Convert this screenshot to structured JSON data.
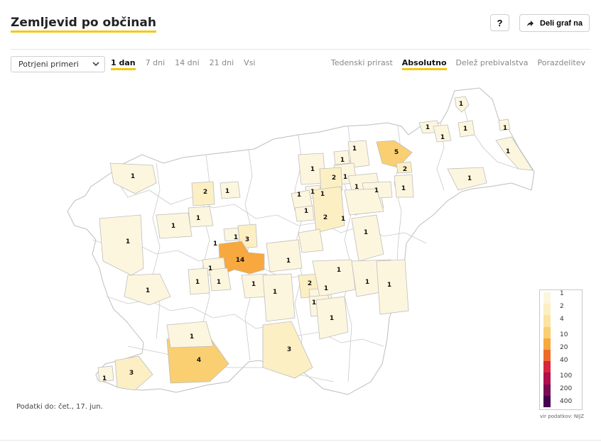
{
  "title": "Zemljevid po občinah",
  "help_label": "?",
  "share_label": "Deli graf na",
  "select": {
    "value": "Potrjeni primeri"
  },
  "ranges": [
    "1 dan",
    "7 dni",
    "14 dni",
    "21 dni",
    "Vsi"
  ],
  "ranges_active": 0,
  "modes": [
    "Tedenski prirast",
    "Absolutno",
    "Delež prebivalstva",
    "Porazdelitev"
  ],
  "modes_active": 1,
  "updated": "Podatki do: čet., 17. jun.",
  "source": "vir podatkov: NIJZ",
  "legend": {
    "ticks": [
      "1",
      "2",
      "4",
      "10",
      "20",
      "40",
      "100",
      "200",
      "400"
    ],
    "colors": [
      "#fdf6de",
      "#fcefc4",
      "#fbe4a0",
      "#f9cf72",
      "#f7a83f",
      "#ee6a2a",
      "#d7263d",
      "#b0104b",
      "#7a0d52",
      "#45004f"
    ]
  },
  "colors": {
    "accent": "#f2c90f",
    "border": "#bdbdbd"
  },
  "map_values": [
    {
      "label": "1",
      "value": 1
    },
    {
      "label": "1",
      "value": 1
    },
    {
      "label": "1",
      "value": 1
    },
    {
      "label": "1",
      "value": 1
    },
    {
      "label": "1",
      "value": 1
    },
    {
      "label": "5",
      "value": 5
    },
    {
      "label": "2",
      "value": 2
    },
    {
      "label": "1",
      "value": 1
    },
    {
      "label": "1",
      "value": 1
    },
    {
      "label": "1",
      "value": 1
    },
    {
      "label": "1",
      "value": 1
    },
    {
      "label": "1",
      "value": 1
    },
    {
      "label": "1",
      "value": 1
    },
    {
      "label": "2",
      "value": 2
    },
    {
      "label": "1",
      "value": 1
    },
    {
      "label": "1",
      "value": 1
    },
    {
      "label": "1",
      "value": 1
    },
    {
      "label": "1",
      "value": 1
    },
    {
      "label": "1",
      "value": 1
    },
    {
      "label": "1",
      "value": 1
    },
    {
      "label": "2",
      "value": 2
    },
    {
      "label": "1",
      "value": 1
    },
    {
      "label": "1",
      "value": 1
    },
    {
      "label": "1",
      "value": 1
    },
    {
      "label": "2",
      "value": 2
    },
    {
      "label": "1",
      "value": 1
    },
    {
      "label": "1",
      "value": 1
    },
    {
      "label": "1",
      "value": 1
    },
    {
      "label": "1",
      "value": 1
    },
    {
      "label": "3",
      "value": 3
    },
    {
      "label": "1",
      "value": 1
    },
    {
      "label": "14",
      "value": 14
    },
    {
      "label": "1",
      "value": 1
    },
    {
      "label": "1",
      "value": 1
    },
    {
      "label": "1",
      "value": 1
    },
    {
      "label": "1",
      "value": 1
    },
    {
      "label": "1",
      "value": 1
    },
    {
      "label": "1",
      "value": 1
    },
    {
      "label": "1",
      "value": 1
    },
    {
      "label": "2",
      "value": 2
    },
    {
      "label": "1",
      "value": 1
    },
    {
      "label": "1",
      "value": 1
    },
    {
      "label": "1",
      "value": 1
    },
    {
      "label": "1",
      "value": 1
    },
    {
      "label": "1",
      "value": 1
    },
    {
      "label": "1",
      "value": 1
    },
    {
      "label": "1",
      "value": 1
    },
    {
      "label": "4",
      "value": 4
    },
    {
      "label": "3",
      "value": 3
    },
    {
      "label": "3",
      "value": 3
    },
    {
      "label": "1",
      "value": 1
    },
    {
      "label": "1",
      "value": 1
    },
    {
      "label": "1",
      "value": 1
    }
  ]
}
